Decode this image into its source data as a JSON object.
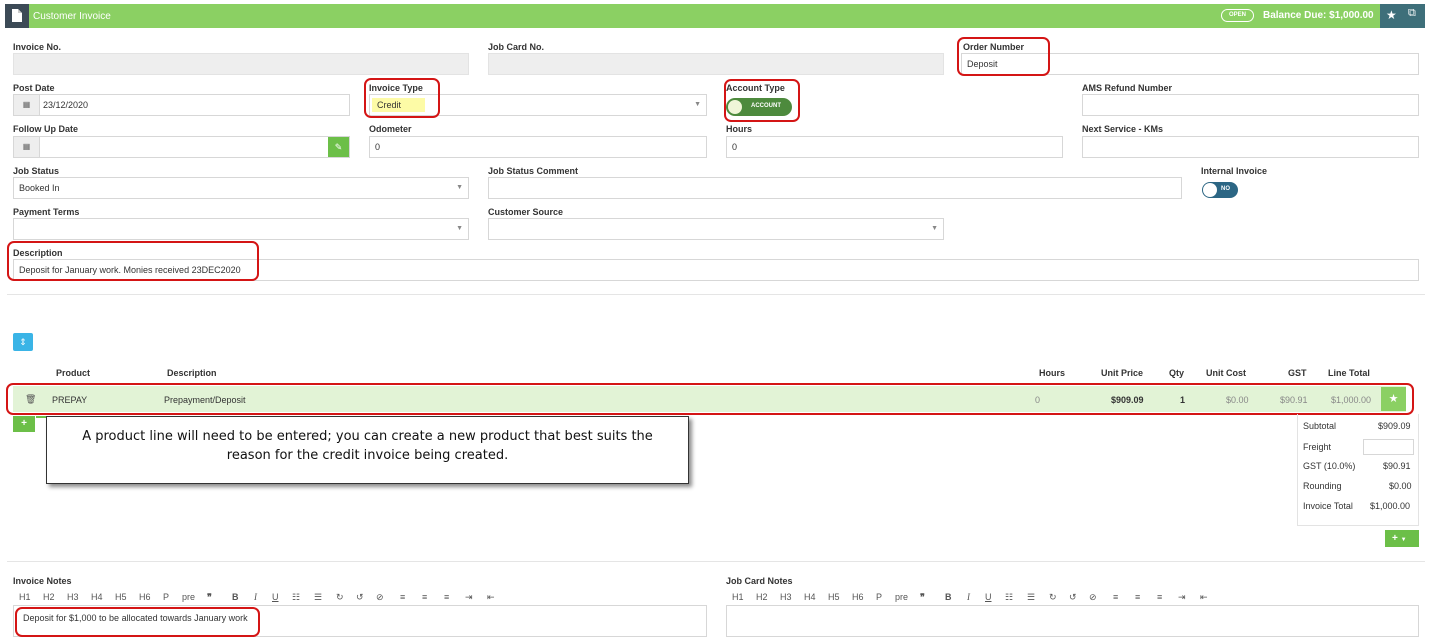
{
  "header": {
    "title": "Customer Invoice",
    "status_badge": "OPEN",
    "balance_due": "Balance Due: $1,000.00"
  },
  "fields": {
    "invoice_no": {
      "label": "Invoice No.",
      "value": ""
    },
    "job_card_no": {
      "label": "Job Card No.",
      "value": ""
    },
    "order_number": {
      "label": "Order Number",
      "value": "Deposit"
    },
    "post_date": {
      "label": "Post Date",
      "value": "23/12/2020"
    },
    "invoice_type": {
      "label": "Invoice Type",
      "value": "Credit"
    },
    "account_type": {
      "label": "Account Type",
      "toggle": "ACCOUNT"
    },
    "ams_refund_number": {
      "label": "AMS Refund Number",
      "value": ""
    },
    "follow_up_date": {
      "label": "Follow Up Date",
      "value": ""
    },
    "odometer": {
      "label": "Odometer",
      "value": "0"
    },
    "hours": {
      "label": "Hours",
      "value": "0"
    },
    "next_service_kms": {
      "label": "Next Service - KMs",
      "value": ""
    },
    "job_status": {
      "label": "Job Status",
      "value": "Booked In"
    },
    "job_status_comment": {
      "label": "Job Status Comment",
      "value": ""
    },
    "internal_invoice": {
      "label": "Internal Invoice",
      "toggle": "NO"
    },
    "payment_terms": {
      "label": "Payment Terms",
      "value": ""
    },
    "customer_source": {
      "label": "Customer Source",
      "value": ""
    },
    "description": {
      "label": "Description",
      "value": "Deposit for January work. Monies received 23DEC2020"
    }
  },
  "lines": {
    "columns": {
      "product": "Product",
      "description": "Description",
      "hours": "Hours",
      "unit_price": "Unit Price",
      "qty": "Qty",
      "unit_cost": "Unit Cost",
      "gst": "GST",
      "line_total": "Line Total"
    },
    "rows": [
      {
        "product": "PREPAY",
        "description": "Prepayment/Deposit",
        "hours": "0",
        "unit_price": "$909.09",
        "qty": "1",
        "unit_cost": "$0.00",
        "gst": "$90.91",
        "line_total": "$1,000.00"
      }
    ]
  },
  "callout": "A product line will need to be entered; you can create a new product that best suits the reason for the credit invoice being created.",
  "totals": {
    "subtotal_label": "Subtotal",
    "subtotal": "$909.09",
    "freight_label": "Freight",
    "freight": "",
    "gst_label": "GST (10.0%)",
    "gst": "$90.91",
    "rounding_label": "Rounding",
    "rounding": "$0.00",
    "invoice_total_label": "Invoice Total",
    "invoice_total": "$1,000.00"
  },
  "notes": {
    "invoice_notes_label": "Invoice Notes",
    "invoice_notes_value": "Deposit for $1,000 to be allocated towards January work",
    "job_card_notes_label": "Job Card Notes",
    "job_card_notes_value": "",
    "toolbar": {
      "h1": "H1",
      "h2": "H2",
      "h3": "H3",
      "h4": "H4",
      "h5": "H5",
      "h6": "H6",
      "p": "P",
      "pre": "pre",
      "quote": "❞",
      "bold": "B",
      "italic": "I",
      "underline": "U",
      "ul": "☷",
      "ol": "☰",
      "redo": "↻",
      "undo": "↺",
      "clear": "⊘",
      "align_left": "≡",
      "align_center": "≡",
      "align_right": "≡",
      "indent": "⇥",
      "outdent": "⇤"
    }
  },
  "colors": {
    "header_green": "#8bd063",
    "dark_slate": "#3c4a56",
    "teal": "#3e6f7a",
    "highlight_red": "#d41515",
    "row_green": "#e2f3d6",
    "toggle_green": "#4d8a3d",
    "toggle_teal": "#2c6684"
  }
}
